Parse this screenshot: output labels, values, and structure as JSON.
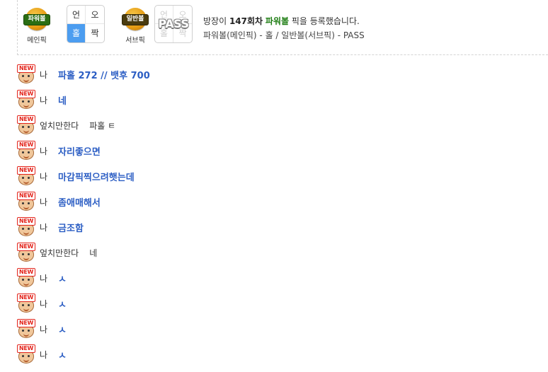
{
  "pick_panel": {
    "main_pick": {
      "ball_label": "파워볼",
      "caption": "메인픽",
      "grid": {
        "top_left": "언",
        "top_right": "오",
        "bottom_left": "홀",
        "bottom_right": "짝"
      },
      "selected": "홀"
    },
    "sub_pick": {
      "ball_label": "일반볼",
      "caption": "서브픽",
      "grid": {
        "top_left": "언",
        "top_right": "오",
        "bottom_left": "홀",
        "bottom_right": "짝"
      },
      "stamp": "PASS"
    },
    "message": {
      "prefix": "방장이 ",
      "round": "147회차",
      "game": "파워볼",
      "suffix": " 픽을 등록했습니다.",
      "detail": "파워볼(메인픽) - 홀 / 일반볼(서브픽) - PASS"
    }
  },
  "chat": {
    "new_badge": "NEW",
    "messages": [
      {
        "nick": "나",
        "text": "파홀 272 // 뱃후 700",
        "mine": true
      },
      {
        "nick": "나",
        "text": "네",
        "mine": true
      },
      {
        "nick": "엎치만한다",
        "text": "파홀 ㅌ",
        "mine": false
      },
      {
        "nick": "나",
        "text": "자리좋으면",
        "mine": true
      },
      {
        "nick": "나",
        "text": "마감픽찍으려햇는데",
        "mine": true
      },
      {
        "nick": "나",
        "text": "좀애매해서",
        "mine": true
      },
      {
        "nick": "나",
        "text": "금조함",
        "mine": true
      },
      {
        "nick": "엎치만한다",
        "text": "네",
        "mine": false
      },
      {
        "nick": "나",
        "text": "ㅅ",
        "mine": true
      },
      {
        "nick": "나",
        "text": "ㅅ",
        "mine": true
      },
      {
        "nick": "나",
        "text": "ㅅ",
        "mine": true
      },
      {
        "nick": "나",
        "text": "ㅅ",
        "mine": true
      }
    ]
  },
  "colors": {
    "mine_text": "#2c5ec4",
    "selected_cell": "#4c9df0",
    "game_name": "#1e7d13",
    "new_badge": "#e3241b"
  }
}
